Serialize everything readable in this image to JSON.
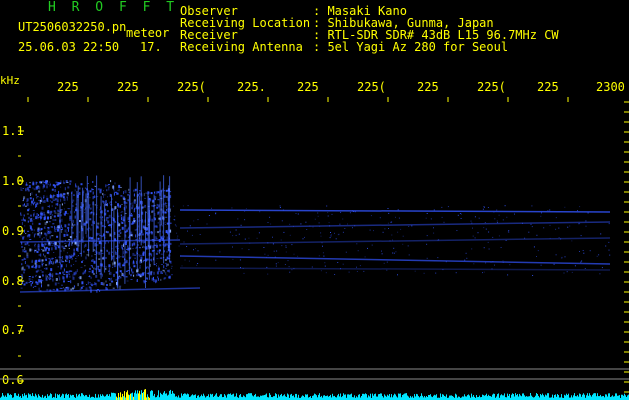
{
  "header": {
    "app_name": "H R O F F T",
    "filename": "UT2506032250.pn",
    "mode": "meteor",
    "datetime": "25.06.03 22:50",
    "count": "17.",
    "fields": [
      {
        "label": "Observer",
        "value": ": Masaki Kano"
      },
      {
        "label": "Receiving Location",
        "value": ": Shibukawa, Gunma, Japan"
      },
      {
        "label": "Receiver",
        "value": ": RTL-SDR SDR# 43dB L15 96.7MHz CW"
      },
      {
        "label": "Receiving Antenna",
        "value": ": 5el Yagi Az 280 for Seoul"
      }
    ]
  },
  "axes": {
    "y_unit": "kHz",
    "y_ticks": [
      "1.1",
      "1.0",
      "0.9",
      "0.8",
      "0.7",
      "0.6"
    ],
    "x_ticks": [
      "225",
      "225",
      "225(",
      "225.",
      "225",
      "225(",
      "225",
      "225(",
      "225",
      "2300"
    ]
  },
  "colors": {
    "background": "#000000",
    "text": "#ffff00",
    "title": "#22cc22",
    "signal": "#3355ff",
    "noise_floor": "#00e5ff"
  }
}
